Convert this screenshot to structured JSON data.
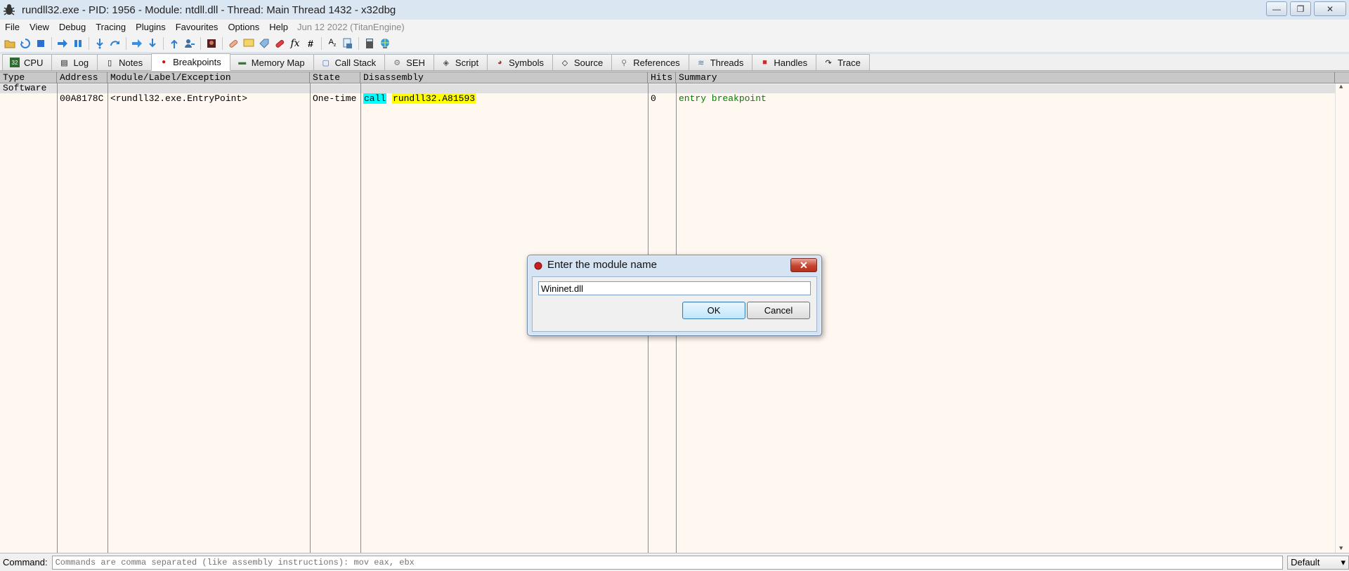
{
  "window": {
    "title": "rundll32.exe - PID: 1956 - Module: ntdll.dll - Thread: Main Thread 1432 - x32dbg",
    "minimize": "—",
    "maximize": "❐",
    "close": "✕"
  },
  "menu": {
    "items": [
      "File",
      "View",
      "Debug",
      "Tracing",
      "Plugins",
      "Favourites",
      "Options",
      "Help"
    ],
    "info": "Jun 12 2022 (TitanEngine)"
  },
  "tabs": [
    {
      "label": "CPU",
      "icon": "cpu-icon",
      "glyph": "▣"
    },
    {
      "label": "Log",
      "icon": "log-icon",
      "glyph": "▤"
    },
    {
      "label": "Notes",
      "icon": "notes-icon",
      "glyph": "▯"
    },
    {
      "label": "Breakpoints",
      "icon": "breakpoint-icon",
      "glyph": "●"
    },
    {
      "label": "Memory Map",
      "icon": "memory-map-icon",
      "glyph": "▬"
    },
    {
      "label": "Call Stack",
      "icon": "call-stack-icon",
      "glyph": "▢"
    },
    {
      "label": "SEH",
      "icon": "seh-icon",
      "glyph": "⚙"
    },
    {
      "label": "Script",
      "icon": "script-icon",
      "glyph": "◈"
    },
    {
      "label": "Symbols",
      "icon": "symbols-icon",
      "glyph": "◕"
    },
    {
      "label": "Source",
      "icon": "source-icon",
      "glyph": "◇"
    },
    {
      "label": "References",
      "icon": "references-icon",
      "glyph": "⚲"
    },
    {
      "label": "Threads",
      "icon": "threads-icon",
      "glyph": "≋"
    },
    {
      "label": "Handles",
      "icon": "handles-icon",
      "glyph": "■"
    },
    {
      "label": "Trace",
      "icon": "trace-icon",
      "glyph": "↷"
    }
  ],
  "breakpoints": {
    "columns": [
      "Type",
      "Address",
      "Module/Label/Exception",
      "State",
      "Disassembly",
      "Hits",
      "Summary"
    ],
    "group": "Software",
    "rows": [
      {
        "type": "",
        "address": "00A8178C",
        "label": "<rundll32.exe.EntryPoint>",
        "state": "One-time",
        "disasm_mnemonic": "call",
        "disasm_operand": "rundll32.A81593",
        "hits": "0",
        "summary": "entry breakpoint"
      }
    ]
  },
  "dialog": {
    "title": "Enter the module name",
    "value": "Wininet.dll",
    "ok": "OK",
    "cancel": "Cancel",
    "close": "✕"
  },
  "command": {
    "label": "Command:",
    "placeholder": "Commands are comma separated (like assembly instructions): mov eax, ebx",
    "mode": "Default",
    "mode_arrow": "▾"
  },
  "colors": {
    "table_background": "#fff8f0",
    "mnemonic_highlight": "#00ffff",
    "operand_highlight": "#ffff00",
    "summary_text": "#008000"
  }
}
